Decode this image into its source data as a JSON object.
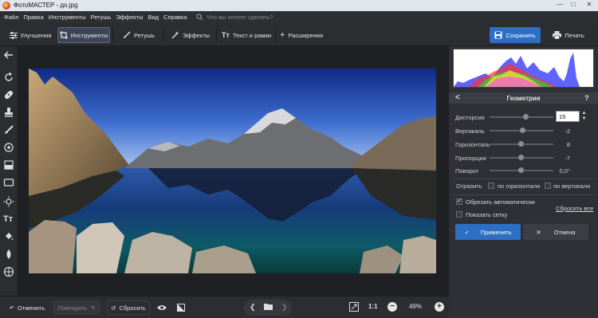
{
  "window": {
    "title": "ФотоМАСТЕР - до.jpg",
    "controls": [
      "—",
      "□",
      "✕"
    ]
  },
  "menu": {
    "items": [
      "Файл",
      "Правка",
      "Инструменты",
      "Ретушь",
      "Эффекты",
      "Вид",
      "Справка"
    ],
    "search_placeholder": "Что вы хотите сделать?"
  },
  "toolbar": {
    "tabs": [
      {
        "label": "Улучшения",
        "icon": "sliders-icon",
        "active": false
      },
      {
        "label": "Инструменты",
        "icon": "crop-icon",
        "active": true
      },
      {
        "label": "Ретушь",
        "icon": "brush-icon",
        "active": false
      },
      {
        "label": "Эффекты",
        "icon": "magic-wand-icon",
        "active": false
      },
      {
        "label": "Текст и рамки",
        "icon": "text-icon",
        "active": false
      },
      {
        "label": "Расширения",
        "icon": "plus-icon",
        "active": false
      }
    ],
    "save_label": "Сохранить",
    "print_label": "Печать",
    "save_color": "#2d6fc4"
  },
  "left_tools": [
    "back-arrow-icon",
    "rotate-icon",
    "bandage-icon",
    "stamp-icon",
    "brush-icon",
    "radial-icon",
    "gradient-icon",
    "vignette-icon",
    "light-icon",
    "text-icon",
    "fill-icon",
    "blur-icon",
    "globe-icon"
  ],
  "panel": {
    "title": "Геометрия",
    "help": "?",
    "back": "<",
    "sliders": [
      {
        "label": "Дисторсия",
        "value": "15",
        "level": 0.55
      },
      {
        "label": "Вертикаль",
        "value": "-2",
        "level": 0.49
      },
      {
        "label": "Горизонталь",
        "value": "8",
        "level": 0.52
      },
      {
        "label": "Пропорции",
        "value": "-7",
        "level": 0.47
      },
      {
        "label": "Поворот",
        "value": "0,0°",
        "level": 0.5
      }
    ],
    "reflect_label": "Отразить",
    "reflect_horizontal": "по горизонтали",
    "reflect_vertical": "по вертикали",
    "crop_auto": {
      "label": "Обрезать автоматически",
      "checked": true
    },
    "show_grid": {
      "label": "Показать сетку",
      "checked": false
    },
    "reset_all": "Сбросить все",
    "apply": "Применить",
    "cancel": "Отмена",
    "apply_color": "#2d6fc4"
  },
  "bottom": {
    "undo": "Отменить",
    "redo": "Повторить",
    "reset": "Сбросить",
    "ratio": "1:1",
    "zoom": "49%"
  }
}
